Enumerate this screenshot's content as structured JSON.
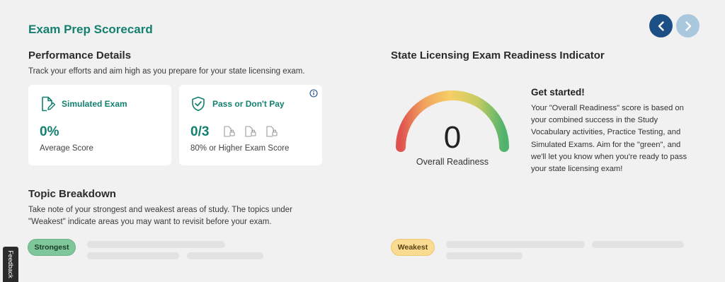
{
  "page": {
    "title": "Exam Prep Scorecard",
    "nav": {
      "prev_icon": "chevron-left-icon",
      "next_icon": "chevron-right-icon"
    }
  },
  "performance": {
    "title": "Performance Details",
    "description": "Track your efforts and aim high as you prepare for your state licensing exam.",
    "cards": [
      {
        "icon": "document-edit-icon",
        "label": "Simulated Exam",
        "value": "0%",
        "sub": "Average Score"
      },
      {
        "icon": "shield-check-icon",
        "label": "Pass or Don't Pay",
        "value": "0/3",
        "sub": "80% or Higher Exam Score",
        "locks": 3,
        "info_icon": "info-icon"
      }
    ]
  },
  "readiness": {
    "title": "State Licensing Exam Readiness Indicator",
    "score": "0",
    "score_label": "Overall Readiness",
    "get_started_title": "Get started!",
    "get_started_text": "Your \"Overall Readiness\" score is based on your combined success in the Study Vocabulary activities, Practice Testing, and Simulated Exams. Aim for the \"green\", and we'll let you know when you're ready to pass your state licensing exam!",
    "gauge_colors": [
      "#e0524f",
      "#f6cf66",
      "#4fb26d"
    ]
  },
  "topics": {
    "title": "Topic Breakdown",
    "description": "Take note of your strongest and weakest areas of study. The topics under \"Weakest\" indicate areas you may want to revisit before your exam.",
    "strongest_label": "Strongest",
    "weakest_label": "Weakest"
  },
  "feedback": {
    "label": "Feedback"
  }
}
